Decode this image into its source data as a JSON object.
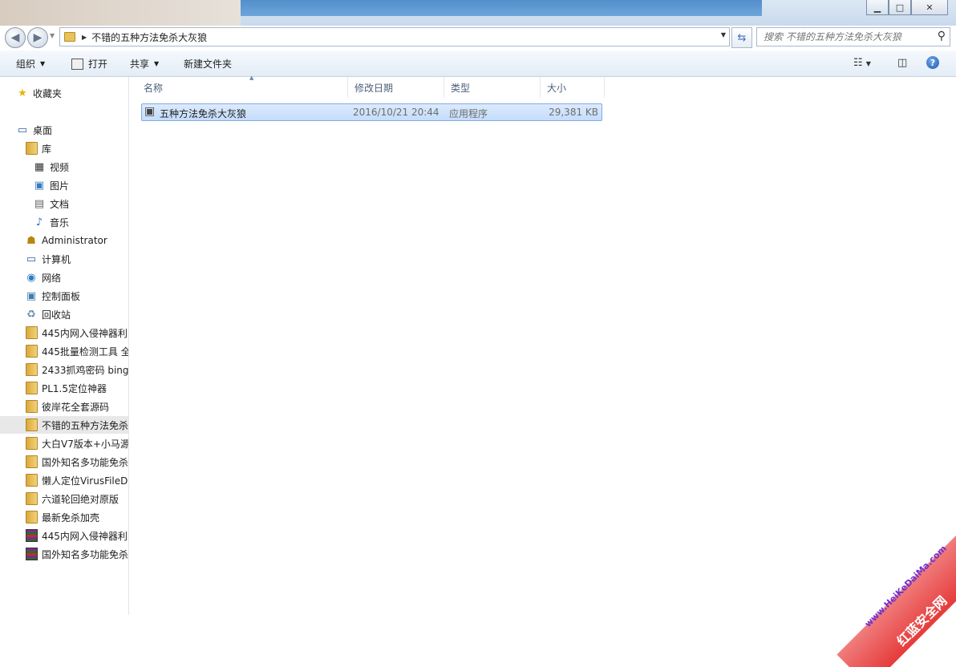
{
  "window": {
    "minimize_label": "▁",
    "maximize_label": "□",
    "close_label": "✕"
  },
  "address": {
    "path": "不错的五种方法免杀大灰狼",
    "search_placeholder": "搜索 不错的五种方法免杀大灰狼"
  },
  "toolbar": {
    "organize": "组织",
    "open": "打开",
    "share": "共享",
    "new_folder": "新建文件夹"
  },
  "nav": {
    "favorites": "收藏夹",
    "desktop": "桌面",
    "libraries": "库",
    "videos": "视频",
    "pictures": "图片",
    "documents": "文档",
    "music": "音乐",
    "administrator": "Administrator",
    "computer": "计算机",
    "network": "网络",
    "control_panel": "控制面板",
    "recycle_bin": "回收站",
    "folders": [
      "445内网入侵神器利",
      "445批量检测工具 全",
      "2433抓鸡密码 bing",
      "PL1.5定位神器",
      "彼岸花全套源码",
      "不错的五种方法免杀",
      "大白V7版本+小马源",
      "国外知名多功能免杀",
      "懒人定位VirusFileD",
      "六道轮回绝对原版",
      "最新免杀加壳"
    ],
    "archives": [
      "445内网入侵神器利",
      "国外知名多功能免杀"
    ]
  },
  "columns": {
    "name": "名称",
    "date": "修改日期",
    "type": "类型",
    "size": "大小"
  },
  "files": [
    {
      "name": "五种方法免杀大灰狼",
      "date": "2016/10/21 20:44",
      "type": "应用程序",
      "size": "29,381 KB"
    }
  ],
  "watermark": {
    "line1": "www.HeiKeDaiMa.com",
    "line2": "红蓝安全网"
  }
}
